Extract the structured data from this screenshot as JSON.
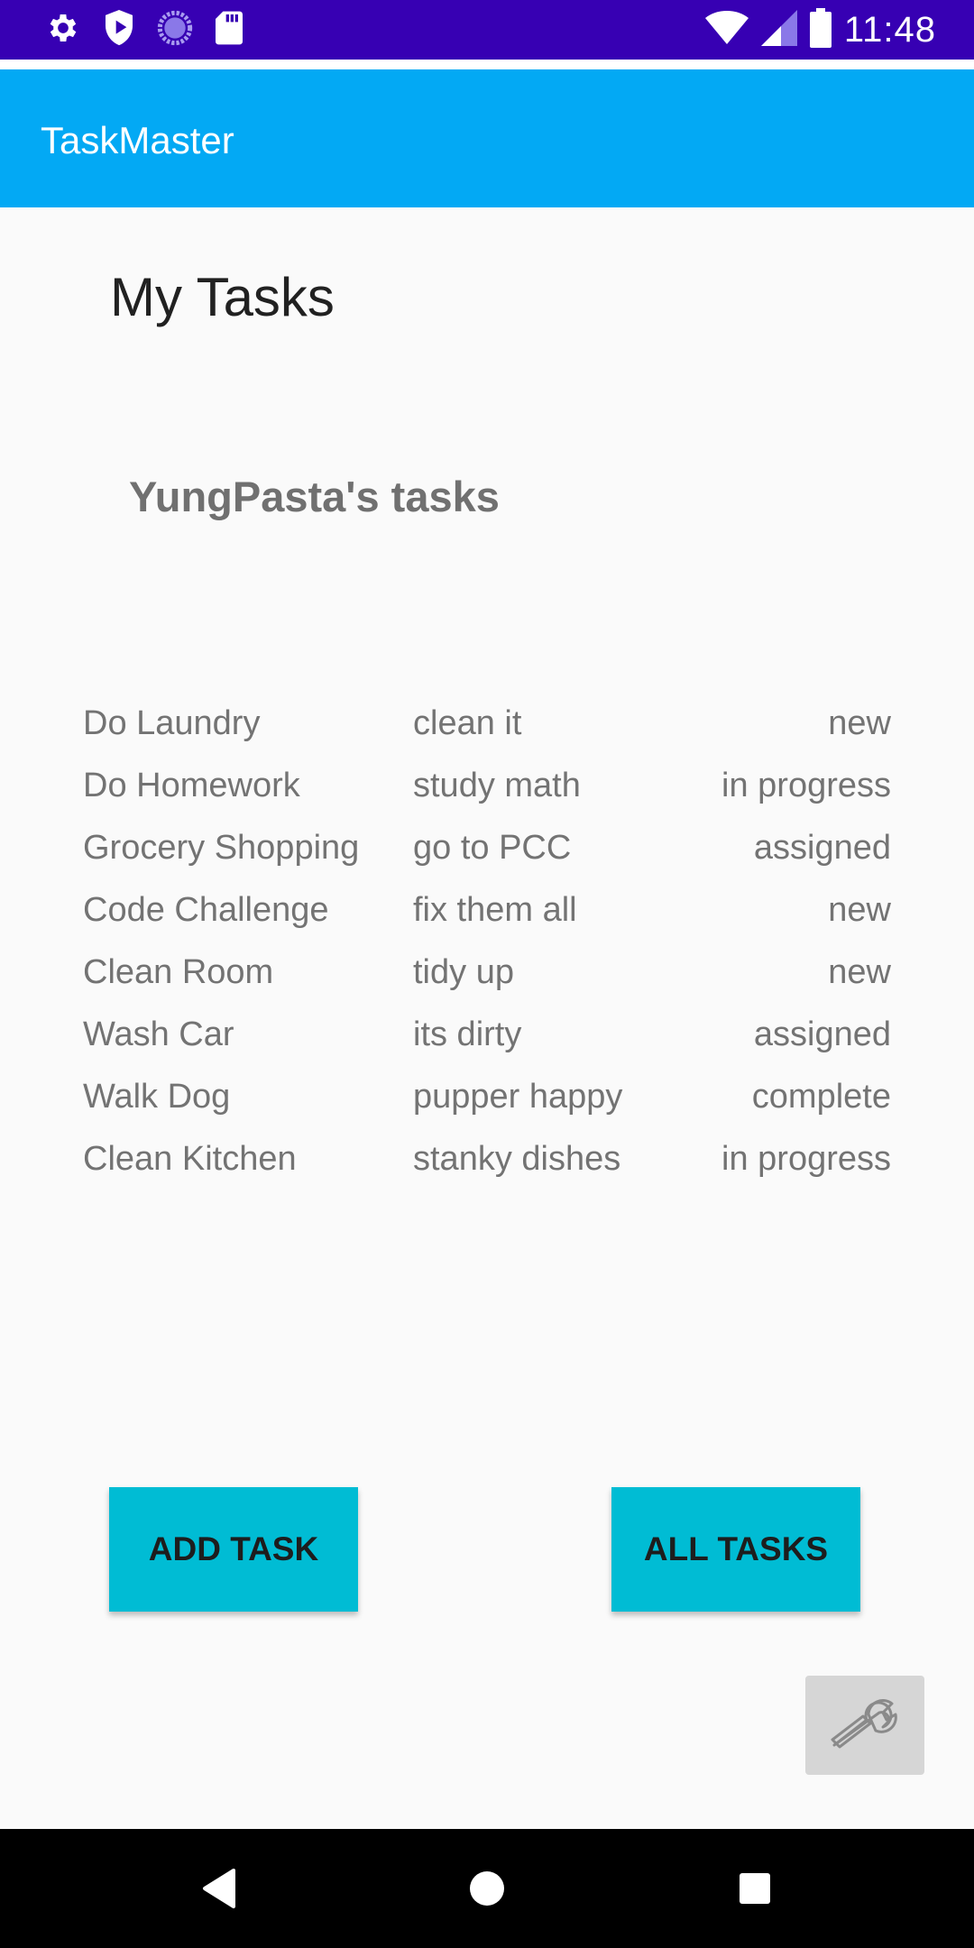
{
  "status_bar": {
    "time": "11:48",
    "left_icons": [
      "gear-icon",
      "play-protect-icon",
      "loading-circle-icon",
      "sd-card-icon"
    ],
    "right_icons": [
      "wifi-icon",
      "signal-icon",
      "battery-icon"
    ]
  },
  "app_bar": {
    "title": "TaskMaster"
  },
  "main": {
    "heading": "My Tasks",
    "user_tasks_label": "YungPasta's tasks",
    "tasks": [
      {
        "title": "Do Laundry",
        "body": "clean it",
        "state": "new"
      },
      {
        "title": "Do Homework",
        "body": "study math",
        "state": "in progress"
      },
      {
        "title": "Grocery Shopping",
        "body": "go to PCC",
        "state": "assigned"
      },
      {
        "title": "Code Challenge",
        "body": "fix them all",
        "state": "new"
      },
      {
        "title": "Clean Room",
        "body": "tidy up",
        "state": "new"
      },
      {
        "title": "Wash Car",
        "body": "its dirty",
        "state": "assigned"
      },
      {
        "title": "Walk Dog",
        "body": "pupper happy",
        "state": "complete"
      },
      {
        "title": "Clean Kitchen",
        "body": "stanky dishes",
        "state": "in progress"
      }
    ],
    "buttons": {
      "add_task": "ADD TASK",
      "all_tasks": "ALL TASKS"
    },
    "settings_icon": "wrench-icon"
  },
  "nav_bar": {
    "icons": [
      "back-icon",
      "home-icon",
      "recents-icon"
    ]
  },
  "colors": {
    "status_bar": "#3700b3",
    "app_bar": "#03a9f4",
    "button": "#00bcd4",
    "background": "#fafafa"
  }
}
